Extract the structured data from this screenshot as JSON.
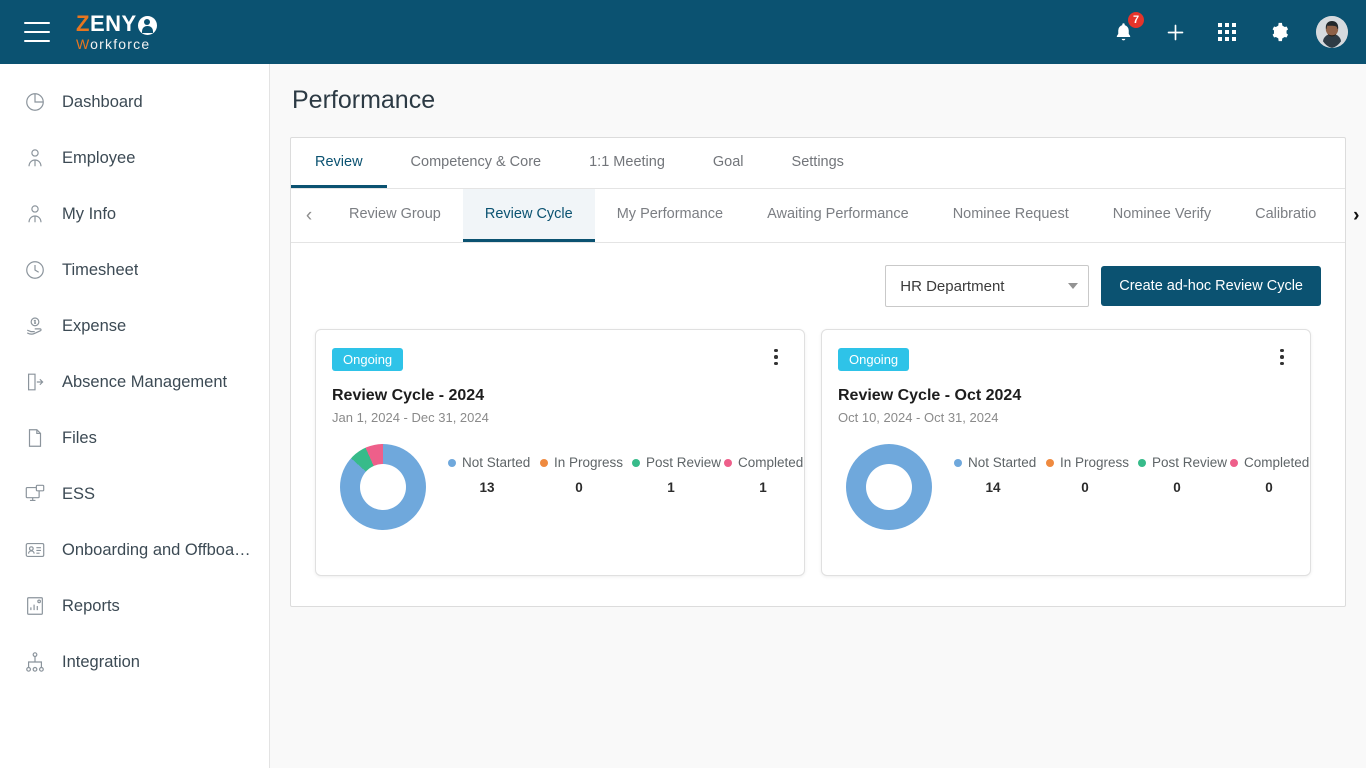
{
  "topbar": {
    "menu_icon": "hamburger-icon",
    "logo": {
      "part1": "Z",
      "part2": "ENY",
      "mark": "person-circle-icon",
      "sub1": "W",
      "sub2": "orkforce"
    },
    "notifications": {
      "icon": "bell-icon",
      "count": "7"
    },
    "add_icon": "plus-icon",
    "apps_icon": "grid-apps-icon",
    "settings_icon": "gear-icon",
    "avatar": "user-avatar"
  },
  "sidebar": {
    "items": [
      {
        "label": "Dashboard",
        "icon": "pie-chart-icon"
      },
      {
        "label": "Employee",
        "icon": "employee-icon"
      },
      {
        "label": "My Info",
        "icon": "employee-icon"
      },
      {
        "label": "Timesheet",
        "icon": "clock-icon"
      },
      {
        "label": "Expense",
        "icon": "money-hand-icon"
      },
      {
        "label": "Absence Management",
        "icon": "door-exit-icon"
      },
      {
        "label": "Files",
        "icon": "document-icon"
      },
      {
        "label": "ESS",
        "icon": "monitor-user-icon"
      },
      {
        "label": "Onboarding and Offboardi...",
        "icon": "id-card-icon"
      },
      {
        "label": "Reports",
        "icon": "report-chart-icon"
      },
      {
        "label": "Integration",
        "icon": "sitemap-icon"
      }
    ]
  },
  "main": {
    "page_title": "Performance",
    "primary_tabs": [
      {
        "label": "Review",
        "active": true
      },
      {
        "label": "Competency & Core",
        "active": false
      },
      {
        "label": "1:1 Meeting",
        "active": false
      },
      {
        "label": "Goal",
        "active": false
      },
      {
        "label": "Settings",
        "active": false
      }
    ],
    "secondary_tabs": {
      "prev_icon": "chevron-left-icon",
      "next_icon": "chevron-right-icon",
      "items": [
        {
          "label": "Review Group",
          "active": false
        },
        {
          "label": "Review Cycle",
          "active": true
        },
        {
          "label": "My Performance",
          "active": false
        },
        {
          "label": "Awaiting Performance",
          "active": false
        },
        {
          "label": "Nominee Request",
          "active": false
        },
        {
          "label": "Nominee Verify",
          "active": false
        },
        {
          "label": "Calibratio",
          "active": false
        }
      ]
    },
    "toolbar": {
      "department_select": "HR Department",
      "department_caret": "chevron-down-icon",
      "create_button": "Create ad-hoc Review Cycle"
    },
    "legend_colors": {
      "not_started": "#6fa8dc",
      "in_progress": "#ef8a3f",
      "post_review": "#37bb8a",
      "completed": "#ee5f8a"
    },
    "cards": [
      {
        "status": "Ongoing",
        "menu_icon": "kebab-menu-icon",
        "title": "Review Cycle - 2024",
        "dates": "Jan 1, 2024 - Dec 31, 2024",
        "stats": [
          {
            "label": "Not Started",
            "value": "13"
          },
          {
            "label": "In Progress",
            "value": "0"
          },
          {
            "label": "Post Review",
            "value": "1"
          },
          {
            "label": "Completed",
            "value": "1"
          }
        ]
      },
      {
        "status": "Ongoing",
        "menu_icon": "kebab-menu-icon",
        "title": "Review Cycle - Oct 2024",
        "dates": "Oct 10, 2024 - Oct 31, 2024",
        "stats": [
          {
            "label": "Not Started",
            "value": "14"
          },
          {
            "label": "In Progress",
            "value": "0"
          },
          {
            "label": "Post Review",
            "value": "0"
          },
          {
            "label": "Completed",
            "value": "0"
          }
        ]
      }
    ]
  },
  "chart_data": [
    {
      "type": "pie",
      "title": "Review Cycle - 2024",
      "categories": [
        "Not Started",
        "In Progress",
        "Post Review",
        "Completed"
      ],
      "values": [
        13,
        0,
        1,
        1
      ],
      "colors": [
        "#6fa8dc",
        "#ef8a3f",
        "#37bb8a",
        "#ee5f8a"
      ],
      "total": 15,
      "legend_position": "right"
    },
    {
      "type": "pie",
      "title": "Review Cycle - Oct 2024",
      "categories": [
        "Not Started",
        "In Progress",
        "Post Review",
        "Completed"
      ],
      "values": [
        14,
        0,
        0,
        0
      ],
      "colors": [
        "#6fa8dc",
        "#ef8a3f",
        "#37bb8a",
        "#ee5f8a"
      ],
      "total": 14,
      "legend_position": "right"
    }
  ]
}
